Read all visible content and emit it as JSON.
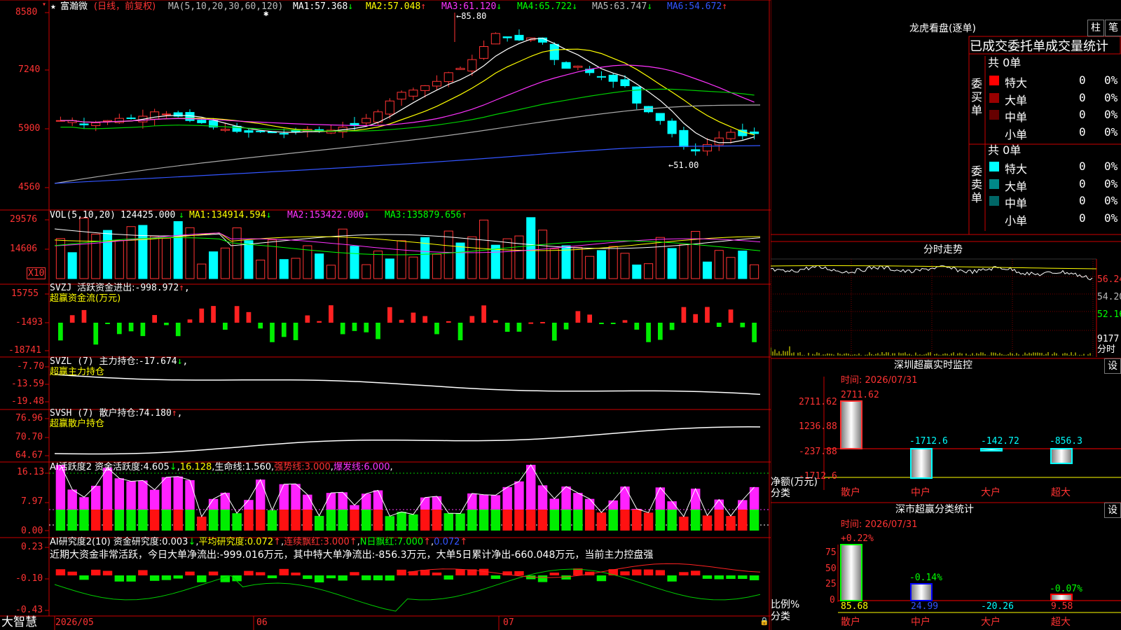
{
  "app": {
    "brand": "大智慧"
  },
  "kline": {
    "header": {
      "star": "★",
      "stock": "富瀚微",
      "period": "(日线，前复权)",
      "ma_params": "MA(5,10,20,30,60,120)"
    },
    "mas": [
      {
        "label": "MA1:",
        "value": "57.368",
        "arrow": "↓",
        "color": "#ffffff"
      },
      {
        "label": "MA2:",
        "value": "57.048",
        "arrow": "↑",
        "color": "#ffff00"
      },
      {
        "label": "MA3:",
        "value": "61.120",
        "arrow": "↓",
        "color": "#ff33ff"
      },
      {
        "label": "MA4:",
        "value": "65.722",
        "arrow": "↓",
        "color": "#00ff00"
      },
      {
        "label": "MA5:",
        "value": "63.747",
        "arrow": "↓",
        "color": "#bbbbbb"
      },
      {
        "label": "MA6:",
        "value": "54.672",
        "arrow": "↑",
        "color": "#3355ff"
      }
    ],
    "yticks": [
      "8580",
      "7240",
      "5900",
      "4560"
    ],
    "high_label": "←85.80",
    "low_label": "←51.00",
    "marker": "✱"
  },
  "vol": {
    "name": "VOL(5,10,20)",
    "value": "124425.000",
    "arrow": "↓",
    "mas": [
      {
        "label": "MA1:",
        "value": "134914.594",
        "arrow": "↓"
      },
      {
        "label": "MA2:",
        "value": "153422.000",
        "arrow": "↓"
      },
      {
        "label": "MA3:",
        "value": "135879.656",
        "arrow": "↑"
      }
    ],
    "yticks": [
      "29576",
      "14606"
    ],
    "unit": "X10"
  },
  "svzj": {
    "name": "SVZJ",
    "label": "活跃资金进出:",
    "value": "-998.972",
    "arrow": "↑",
    "sub": "超赢资金流(万元)",
    "yticks": [
      "15755",
      "-1493",
      "-18741"
    ]
  },
  "svzl": {
    "name": "SVZL (7)",
    "label": "主力持仓:",
    "value": "-17.674",
    "arrow": "↓",
    "sub": "超赢主力持仓",
    "yticks": [
      "-7.70",
      "-13.59",
      "-19.48"
    ]
  },
  "svsh": {
    "name": "SVSH (7)",
    "label": "散户持仓:",
    "value": "74.180",
    "arrow": "↑",
    "sub": "超赢散户持仓",
    "yticks": [
      "76.96",
      "70.70",
      "64.67"
    ]
  },
  "ai2": {
    "name": "AI活跃度2",
    "label": "资金活跃度:",
    "value": "4.605",
    "arrow": "↓",
    "v2": "16.128",
    "l3": "生命线:",
    "v3": "1.560",
    "l4": "强势线:",
    "v4": "3.000",
    "l5": "爆发线:",
    "v5": "6.000",
    "yticks": [
      "16.13",
      "7.97",
      "0.00"
    ]
  },
  "ai_research": {
    "name": "AI研究度2(10)",
    "label": "资金研究度:",
    "value": "0.003",
    "arrow": "↓",
    "l2": "平均研究度:",
    "v2": "0.072",
    "l3": "连续飘红:",
    "v3": "3.000",
    "l4": "N日飘红:",
    "v4": "7.000",
    "v5": "0.072",
    "comment": "近期大资金非常活跃，今日大单净流出:-999.016万元，其中特大单净流出:-856.3万元，大单5日累计净出-660.048万元，当前主力控盘强",
    "yticks": [
      "0.23",
      "-0.10",
      "-0.43"
    ]
  },
  "xaxis": {
    "labels": [
      "2026/05",
      "06",
      "07"
    ]
  },
  "right": {
    "lhkp": {
      "title": "龙虎看盘(逐单)",
      "btn1": "柱",
      "btn2": "笔",
      "subtitle": "已成交委托单成交量统计",
      "buy": {
        "side": "委买单",
        "total": "共 0单",
        "rows": [
          {
            "name": "特大",
            "val": "0",
            "pct": "0%",
            "color": "#ff0000"
          },
          {
            "name": "大单",
            "val": "0",
            "pct": "0%",
            "color": "#990000"
          },
          {
            "name": "中单",
            "val": "0",
            "pct": "0%",
            "color": "#660000"
          },
          {
            "name": "小单",
            "val": "0",
            "pct": "0%",
            "color": "#000000"
          }
        ]
      },
      "sell": {
        "side": "委卖单",
        "total": "共 0单",
        "rows": [
          {
            "name": "特大",
            "val": "0",
            "pct": "0%",
            "color": "#00ffff"
          },
          {
            "name": "大单",
            "val": "0",
            "pct": "0%",
            "color": "#008888"
          },
          {
            "name": "中单",
            "val": "0",
            "pct": "0%",
            "color": "#006666"
          },
          {
            "name": "小单",
            "val": "0",
            "pct": "0%",
            "color": "#000000"
          }
        ]
      }
    },
    "fenshi": {
      "title": "分时走势",
      "yticks": [
        "56.24",
        "54.20",
        "52.16",
        "9177"
      ],
      "vol_label": "分时"
    },
    "monitor": {
      "title": "深圳超赢实时监控",
      "btn": "设",
      "time_label": "时间:",
      "time": "2026/07/31",
      "yticks": [
        "2711.62",
        "1236.88",
        "-237.88",
        "-1712.6"
      ],
      "ylab1": "净额(万元)",
      "ylab2": "分类",
      "cats": [
        "散户",
        "中户",
        "大户",
        "超大"
      ],
      "values": [
        "2711.62",
        "-1712.6",
        "-142.72",
        "-856.3"
      ]
    },
    "classify": {
      "title": "深市超赢分类统计",
      "btn": "设",
      "time_label": "时间:",
      "time": "2026/07/31",
      "yticks": [
        "75",
        "50",
        "25",
        "0"
      ],
      "ylab1": "比例%",
      "ylab2": "分类",
      "cats": [
        "散户",
        "中户",
        "大户",
        "超大"
      ],
      "top": [
        "+0.22%",
        "-0.14%",
        "",
        "-0.07%"
      ],
      "bottom": [
        "85.68",
        "24.99",
        "-20.26",
        "9.58"
      ]
    }
  }
}
